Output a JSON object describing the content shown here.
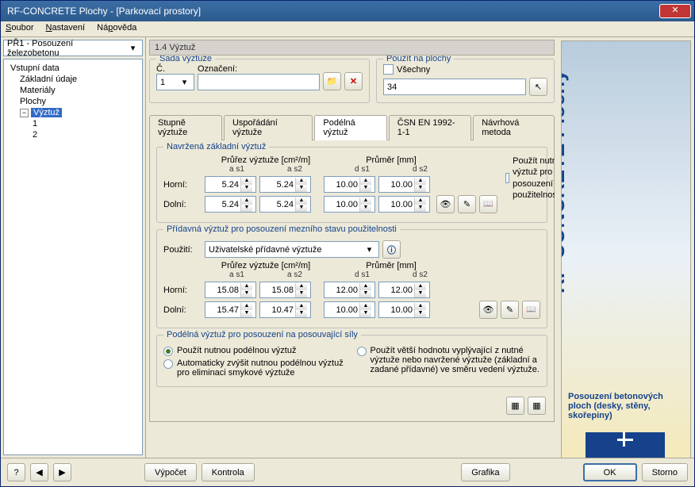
{
  "window": {
    "title": "RF-CONCRETE Plochy - [Parkovací prostory]"
  },
  "menu": {
    "file": "Soubor",
    "settings": "Nastavení",
    "help": "Nápověda"
  },
  "combo_case": "PŘ1 - Posouzení železobetonu",
  "section_title": "1.4 Výztuž",
  "tree": {
    "root": "Vstupní data",
    "n1": "Základní údaje",
    "n2": "Materiály",
    "n3": "Plochy",
    "n4": "Výztuž",
    "n4a": "1",
    "n4b": "2"
  },
  "sada": {
    "title": "Sada výztuže",
    "c_lbl": "Č.",
    "c_val": "1",
    "ozn_lbl": "Označení:",
    "ozn_val": ""
  },
  "pouzit": {
    "title": "Použít na plochy",
    "all": "Všechny",
    "val": "34"
  },
  "tabs": {
    "t1": "Stupně výztuže",
    "t2": "Uspořádání výztuže",
    "t3": "Podélná výztuž",
    "t4": "ČSN EN 1992-1-1",
    "t5": "Návrhová metoda"
  },
  "grp1": {
    "title": "Navržená základní výztuž",
    "sec_hdr": "Průřez výztuže  [cm²/m]",
    "dia_hdr": "Průměr  [mm]",
    "as1": "a s1",
    "as2": "a s2",
    "ds1": "d s1",
    "ds2": "d s2",
    "horni": "Horní:",
    "dolni": "Dolní:",
    "h_as1": "5.24",
    "h_as2": "5.24",
    "h_ds1": "10.00",
    "h_ds2": "10.00",
    "d_as1": "5.24",
    "d_as2": "5.24",
    "d_ds1": "10.00",
    "d_ds2": "10.00",
    "chk": "Použít nutnou výztuž pro posouzení použitelnosti"
  },
  "grp2": {
    "title": "Přídavná výztuž pro posouzení mezního stavu použitelnosti",
    "pouziti_lbl": "Použití:",
    "pouziti_val": "Uživatelské přídavné výztuže",
    "h_as1": "15.08",
    "h_as2": "15.08",
    "h_ds1": "12.00",
    "h_ds2": "12.00",
    "d_as1": "15.47",
    "d_as2": "10.47",
    "d_ds1": "10.00",
    "d_ds2": "10.00"
  },
  "grp3": {
    "title": "Podélná výztuž pro posouzení na posouvající síly",
    "r1": "Použít nutnou podélnou výztuž",
    "r2": "Automaticky zvýšit nutnou podélnou výztuž pro eliminaci smykové výztuže",
    "r3": "Použít větší hodnotu vyplývající z nutné výztuže nebo navržené výztuže (základní a zadané přídavné) ve směru vedení výztuže."
  },
  "banner": {
    "main": "RF-CONCRETE Plochy",
    "sub": "Posouzení betonových ploch (desky, stěny, skořepiny)"
  },
  "footer": {
    "vypocet": "Výpočet",
    "kontrola": "Kontrola",
    "grafika": "Grafika",
    "ok": "OK",
    "storno": "Storno"
  }
}
